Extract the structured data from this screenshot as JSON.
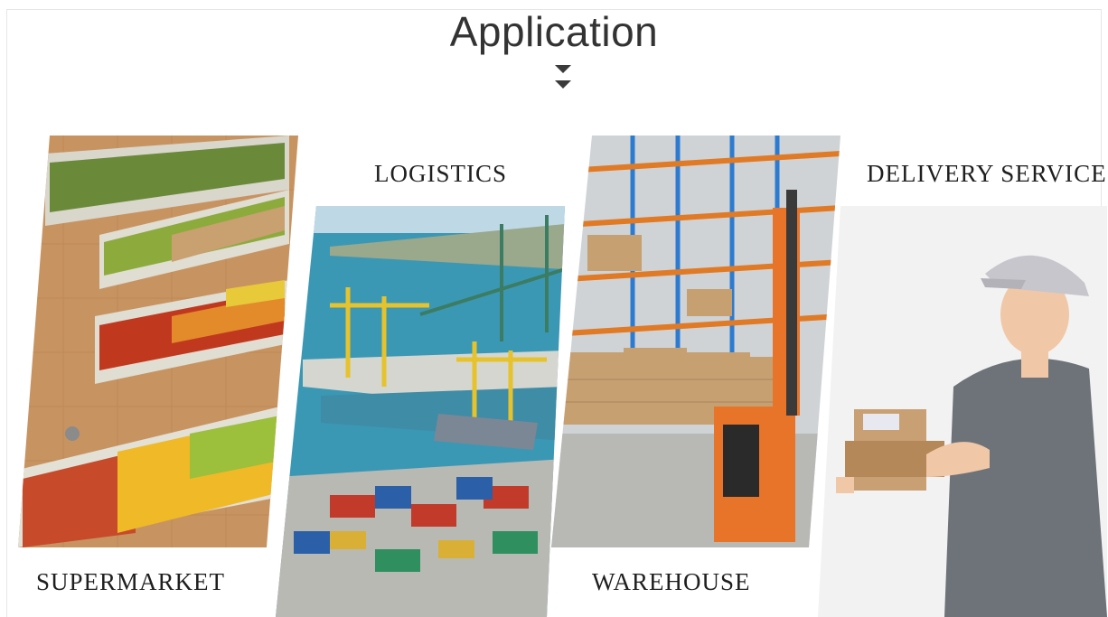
{
  "heading": "Application",
  "arrow_icon": "double-chevron-down-icon",
  "categories": [
    {
      "id": "supermarket",
      "label": "SUPERMARKET"
    },
    {
      "id": "logistics",
      "label": "LOGISTICS"
    },
    {
      "id": "warehouse",
      "label": "WAREHOUSE"
    },
    {
      "id": "delivery",
      "label": "DELIVERY SERVICE"
    }
  ],
  "colors": {
    "heading": "#333333",
    "label": "#1f1f1f",
    "arrow": "#3a3a3a",
    "frame": "#e6e6e6"
  }
}
